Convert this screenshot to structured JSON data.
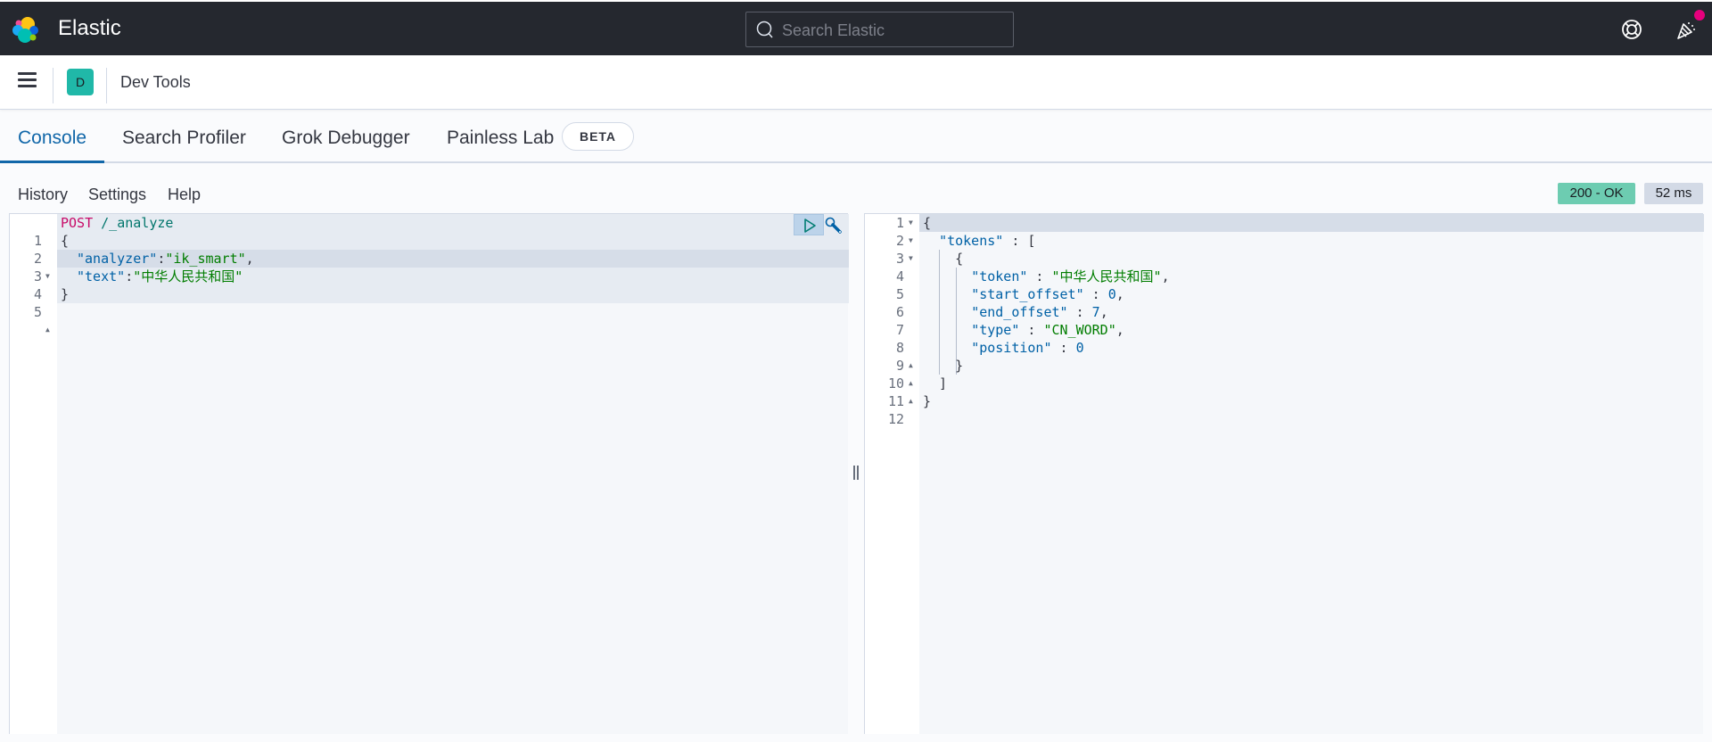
{
  "header": {
    "brand": "Elastic",
    "search_placeholder": "Search Elastic",
    "icons": [
      "elastic-logo",
      "search-icon",
      "help-icon",
      "newsfeed-icon"
    ],
    "news_badge_color": "#e7007d"
  },
  "subheader": {
    "avatar_letter": "D",
    "avatar_color": "#20b8a8",
    "breadcrumb": "Dev Tools"
  },
  "tabs": [
    {
      "label": "Console",
      "active": true
    },
    {
      "label": "Search Profiler",
      "active": false
    },
    {
      "label": "Grok Debugger",
      "active": false
    },
    {
      "label": "Painless Lab",
      "active": false,
      "badge": "BETA"
    }
  ],
  "toolbar": {
    "history": "History",
    "settings": "Settings",
    "help": "Help",
    "status": "200 - OK",
    "status_color": "#6dccb1",
    "time": "52 ms"
  },
  "request": {
    "lines": [
      {
        "n": "1",
        "fold": ""
      },
      {
        "n": "2",
        "fold": "down"
      },
      {
        "n": "3",
        "fold": ""
      },
      {
        "n": "4",
        "fold": ""
      },
      {
        "n": "5",
        "fold": "up"
      }
    ],
    "method": "POST",
    "path": "/_analyze",
    "open_brace": "{",
    "close_brace": "}",
    "analyzer_key": "\"analyzer\"",
    "analyzer_value": "\"ik_smart\"",
    "text_key": "\"text\"",
    "text_value": "\"中华人民共和国\""
  },
  "response": {
    "lines": [
      {
        "n": "1",
        "fold": "down"
      },
      {
        "n": "2",
        "fold": "down"
      },
      {
        "n": "3",
        "fold": "down"
      },
      {
        "n": "4",
        "fold": ""
      },
      {
        "n": "5",
        "fold": ""
      },
      {
        "n": "6",
        "fold": ""
      },
      {
        "n": "7",
        "fold": ""
      },
      {
        "n": "8",
        "fold": ""
      },
      {
        "n": "9",
        "fold": "up"
      },
      {
        "n": "10",
        "fold": "up"
      },
      {
        "n": "11",
        "fold": "up"
      },
      {
        "n": "12",
        "fold": ""
      }
    ],
    "tokens_key": "\"tokens\"",
    "token_key": "\"token\"",
    "token_value": "\"中华人民共和国\"",
    "start_offset_key": "\"start_offset\"",
    "start_offset": "0",
    "end_offset_key": "\"end_offset\"",
    "end_offset": "7",
    "type_key": "\"type\"",
    "type_value": "\"CN_WORD\"",
    "position_key": "\"position\"",
    "position": "0"
  }
}
